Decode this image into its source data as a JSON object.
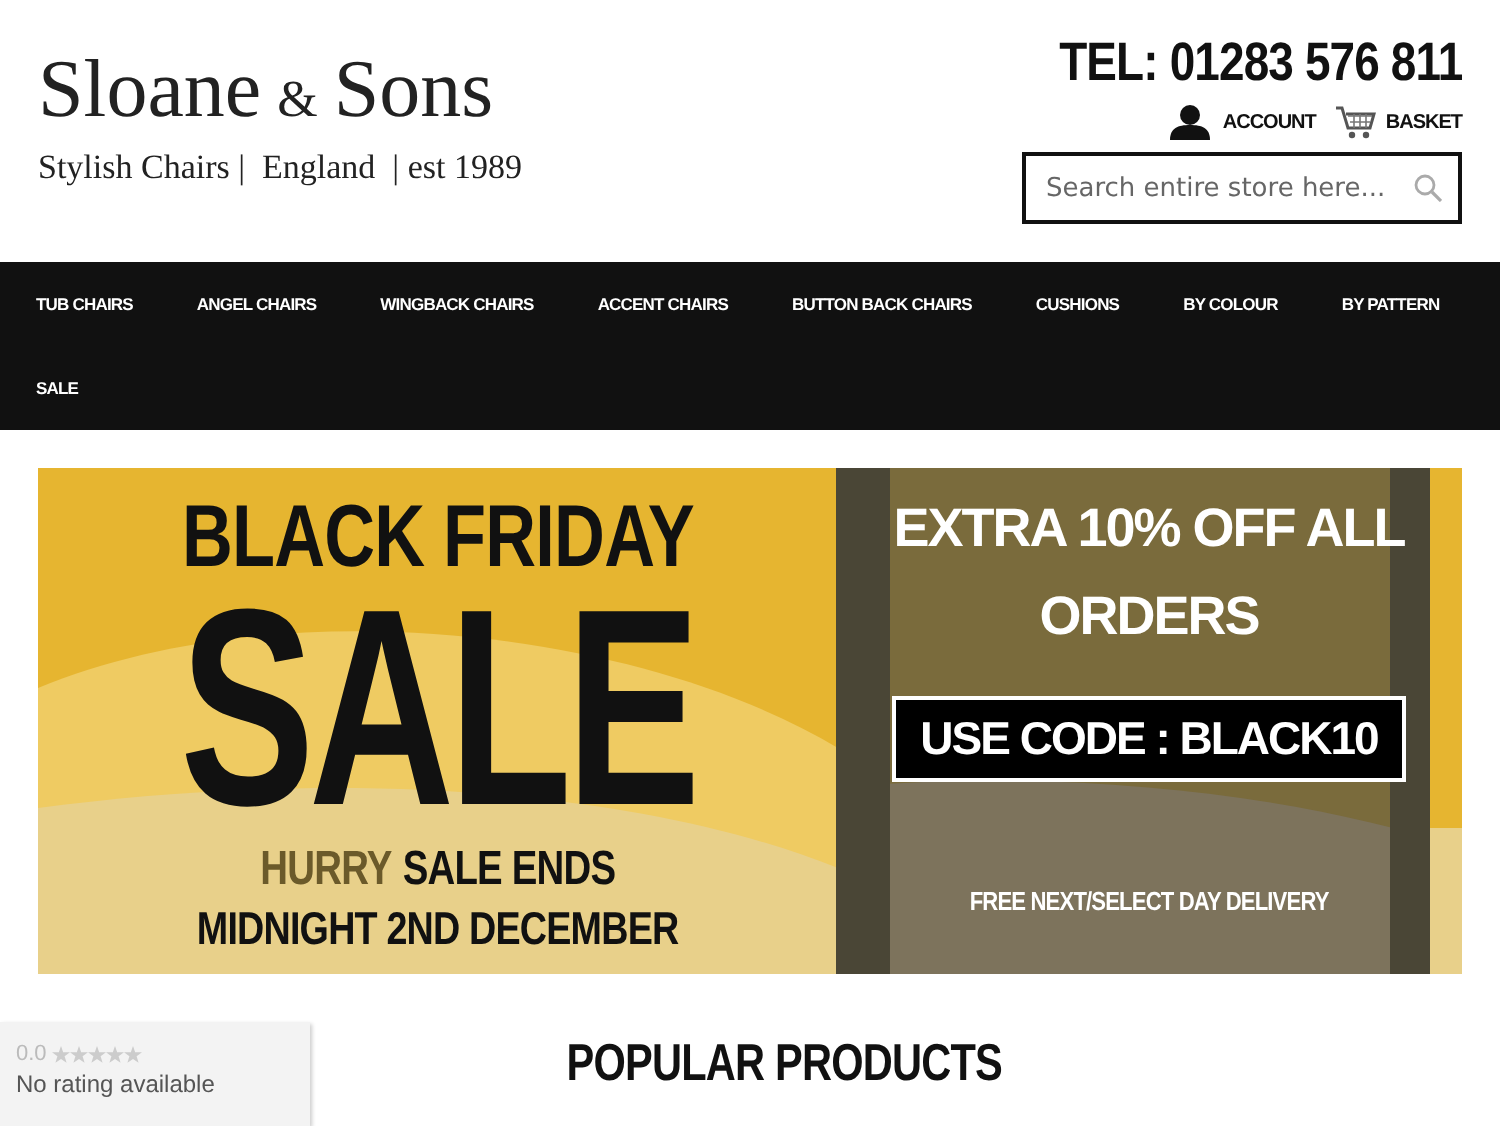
{
  "header": {
    "logo": {
      "name": "Sloane",
      "amp": "&",
      "name2": "Sons",
      "tagline": "Stylish Chairs |  England  | est 1989"
    },
    "phone": "TEL: 01283 576 811",
    "links": [
      {
        "kind": "account",
        "label": "ACCOUNT"
      },
      {
        "kind": "basket",
        "label": "BASKET"
      }
    ],
    "search": {
      "placeholder": "Search entire store here..."
    }
  },
  "nav": {
    "items": [
      "TUB CHAIRS",
      "ANGEL CHAIRS",
      "WINGBACK CHAIRS",
      "ACCENT CHAIRS",
      "BUTTON BACK CHAIRS",
      "CUSHIONS",
      "BY COLOUR",
      "BY PATTERN",
      "SALE"
    ]
  },
  "banner": {
    "title": "BLACK FRIDAY",
    "big": "SALE",
    "hurry": "HURRY",
    "ends": "SALE ENDS",
    "date": "MIDNIGHT 2ND DECEMBER",
    "offer": "EXTRA 10% OFF ALL ORDERS",
    "code": "USE CODE : BLACK10",
    "delivery": "FREE NEXT/SELECT DAY DELIVERY"
  },
  "rating": {
    "score": "0.0",
    "stars": 0,
    "text": "No rating available"
  },
  "section_title": "POPULAR PRODUCTS"
}
